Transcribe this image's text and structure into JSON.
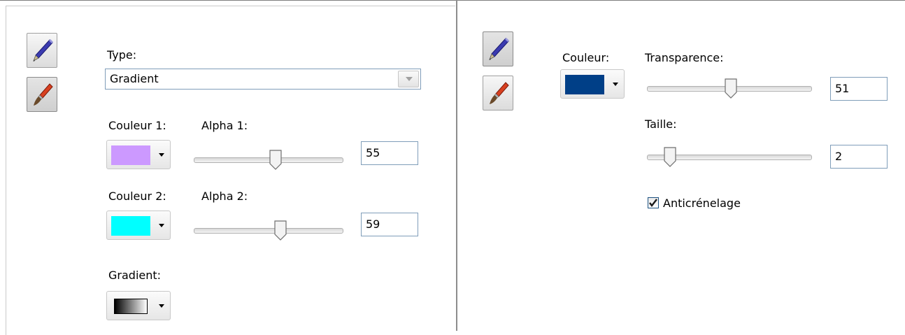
{
  "left_panel": {
    "tools": [
      {
        "name": "pen",
        "selected": false
      },
      {
        "name": "brush",
        "selected": true
      }
    ],
    "type_label": "Type:",
    "type_value": "Gradient",
    "color1_label": "Couleur 1:",
    "color1_value": "#cc99ff",
    "alpha1_label": "Alpha 1:",
    "alpha1_value": "55",
    "color2_label": "Couleur 2:",
    "color2_value": "#00ffff",
    "alpha2_label": "Alpha 2:",
    "alpha2_value": "59",
    "gradient_label": "Gradient:",
    "gradient_colors": [
      "#000000",
      "#ffffff"
    ]
  },
  "right_panel": {
    "tools": [
      {
        "name": "pen",
        "selected": true
      },
      {
        "name": "brush",
        "selected": false
      }
    ],
    "color_label": "Couleur:",
    "color_value": "#003f87",
    "transparency_label": "Transparence:",
    "transparency_value": "51",
    "size_label": "Taille:",
    "size_value": "2",
    "antialias_label": "Anticrénelage",
    "antialias_checked": true
  }
}
